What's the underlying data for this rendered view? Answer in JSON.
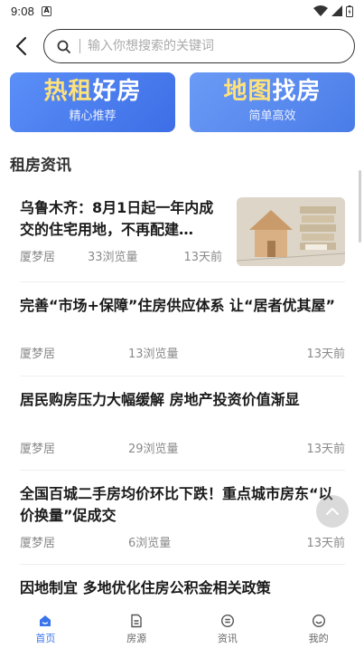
{
  "status_bar": {
    "time": "9:08",
    "notification_badge": "A"
  },
  "search": {
    "placeholder": "输入你想搜索的关键词"
  },
  "banners": [
    {
      "title_highlight": "热租",
      "title_rest": "好房",
      "subtitle": "精心推荐"
    },
    {
      "title_highlight": "地图",
      "title_rest": "找房",
      "subtitle": "简单高效"
    }
  ],
  "section_title": "租房资讯",
  "news": [
    {
      "title": "乌鲁木齐：8月1日起一年内成交的住宅用地，不再配建…",
      "source": "厦梦居",
      "views": "33浏览量",
      "time": "13天前"
    },
    {
      "title": "完善“市场+保障”住房供应体系 让“居者优其屋”",
      "source": "厦梦居",
      "views": "13浏览量",
      "time": "13天前"
    },
    {
      "title": "居民购房压力大幅缓解 房地产投资价值渐显",
      "source": "厦梦居",
      "views": "29浏览量",
      "time": "13天前"
    },
    {
      "title": "全国百城二手房均价环比下跌！重点城市房东“以价换量”促成交",
      "source": "厦梦居",
      "views": "6浏览量",
      "time": "13天前"
    },
    {
      "title": "因地制宜 多地优化住房公积金相关政策"
    }
  ],
  "bottom_nav": [
    {
      "label": "首页",
      "icon": "home-icon"
    },
    {
      "label": "房源",
      "icon": "listing-icon"
    },
    {
      "label": "资讯",
      "icon": "news-icon"
    },
    {
      "label": "我的",
      "icon": "profile-icon"
    }
  ],
  "colors": {
    "accent": "#3a74ea",
    "banner_highlight": "#ffe27a"
  }
}
